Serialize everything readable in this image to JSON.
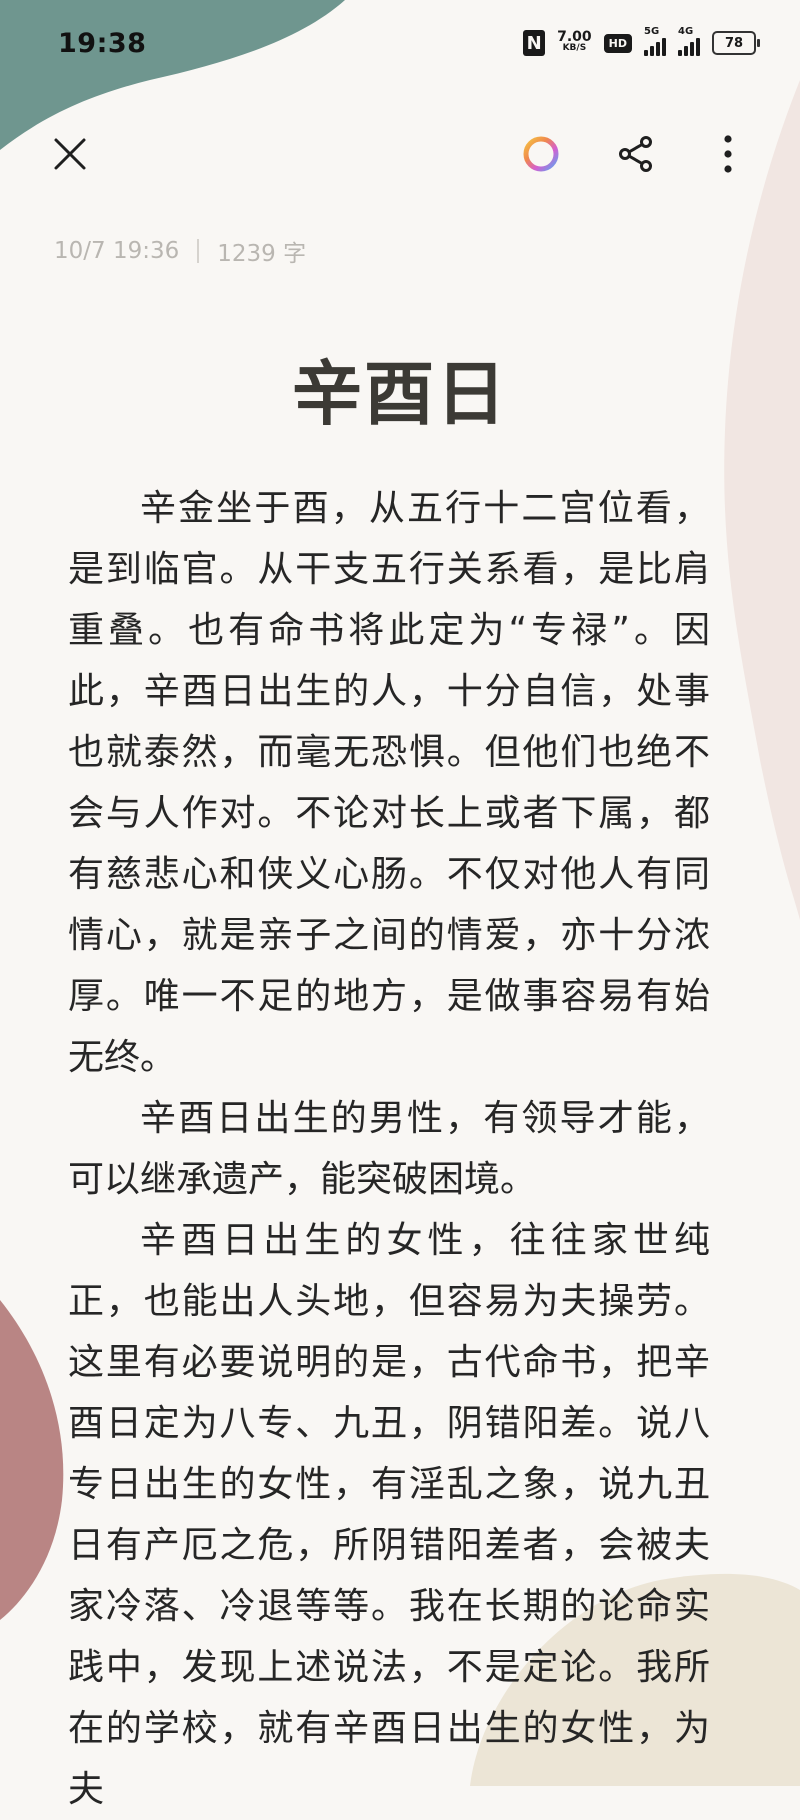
{
  "status_bar": {
    "time": "19:38",
    "nfc": "N",
    "net_speed_value": "7.00",
    "net_speed_unit": "KB/S",
    "hd_label": "HD",
    "signal1_tag": "5G",
    "signal2_tag": "4G",
    "battery": "78"
  },
  "toolbar": {
    "close_icon": "close-icon",
    "theme_icon": "color-ring-icon",
    "share_icon": "share-icon",
    "more_icon": "more-vertical-icon"
  },
  "note": {
    "timestamp": "10/7 19:36",
    "word_count": "1239 字",
    "title": "辛酉日",
    "paragraphs": [
      "辛金坐于酉，从五行十二宫位看，是到临官。从干支五行关系看，是比肩重叠。也有命书将此定为“专禄”。因此，辛酉日出生的人，十分自信，处事也就泰然，而毫无恐惧。但他们也绝不会与人作对。不论对长上或者下属，都有慈悲心和侠义心肠。不仅对他人有同情心，就是亲子之间的情爱，亦十分浓厚。唯一不足的地方，是做事容易有始无终。",
      "辛酉日出生的男性，有领导才能，可以继承遗产，能突破困境。",
      "辛酉日出生的女性，往往家世纯正，也能出人头地，但容易为夫操劳。这里有必要说明的是，古代命书，把辛酉日定为八专、九丑，阴错阳差。说八专日出生的女性，有淫乱之象，说九丑日有产厄之危，所阴错阳差者，会被夫家冷落、冷退等等。我在长期的论命实践中，发现上述说法，不是定论。我所在的学校，就有辛酉日出生的女性，为夫"
    ]
  },
  "theme_colors": {
    "background": "#f9f7f4",
    "blob_teal": "#6f968f",
    "blob_rose": "#b98584",
    "blob_sand": "#ece5d6",
    "blob_blush": "#f1e6e2",
    "title_color": "#3c3a35",
    "meta_color": "#b9b6b1"
  }
}
